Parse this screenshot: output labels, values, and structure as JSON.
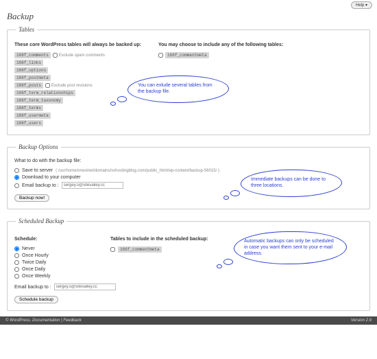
{
  "topbar": {
    "help": "Help ▾"
  },
  "page": {
    "title": "Backup"
  },
  "tables": {
    "legend": "Tables",
    "core_heading": "These core WordPress tables will always be backed up:",
    "optional_heading": "You may choose to include any of the following tables:",
    "core": [
      {
        "name": "166f_comments",
        "extra_label": "Exclude spam comments"
      },
      {
        "name": "166f_links"
      },
      {
        "name": "166f_options"
      },
      {
        "name": "166f_postmeta"
      },
      {
        "name": "166f_posts",
        "extra_label": "Exclude post revisions"
      },
      {
        "name": "166f_term_relationships"
      },
      {
        "name": "166f_term_taxonomy"
      },
      {
        "name": "166f_terms"
      },
      {
        "name": "166f_usermeta"
      },
      {
        "name": "166f_users"
      }
    ],
    "optional": [
      {
        "name": "166f_commentmeta",
        "checked": false
      }
    ]
  },
  "bubble1": "You can exlude several tables from the backup file.",
  "options": {
    "legend": "Backup Options",
    "heading": "What to do with the backup file:",
    "save_label": "Save to server",
    "save_path": "( /usr/home/onestnet/domains/svhostingblog.com/public_html/wp-content/backup-56015/ )",
    "download_label": "Download to your computer",
    "email_label": "Email backup to :",
    "email_value": "sergey.s@sitevalley.cc",
    "button": "Backup now!"
  },
  "bubble2": "Immediate backups can be done to three locations.",
  "scheduled": {
    "legend": "Scheduled Backup",
    "schedule_heading": "Schedule:",
    "tables_heading": "Tables to include in the scheduled backup:",
    "items": [
      {
        "label": "Never",
        "checked": true
      },
      {
        "label": "Once Hourly",
        "checked": false
      },
      {
        "label": "Twice Daily",
        "checked": false
      },
      {
        "label": "Once Daily",
        "checked": false
      },
      {
        "label": "Once Weekly",
        "checked": false
      }
    ],
    "optional": [
      {
        "name": "166f_commentmeta",
        "checked": false
      }
    ],
    "email_label": "Email backup to :",
    "email_value": "sergey.s@sitevalley.cc",
    "button": "Schedule backup"
  },
  "bubble3": "Automatic backups can only be scheduled in case you want them sent to your e-mail address.",
  "footer": {
    "left": "© WordPress.   Documentation | Feedback",
    "right": "Version 2.9"
  }
}
